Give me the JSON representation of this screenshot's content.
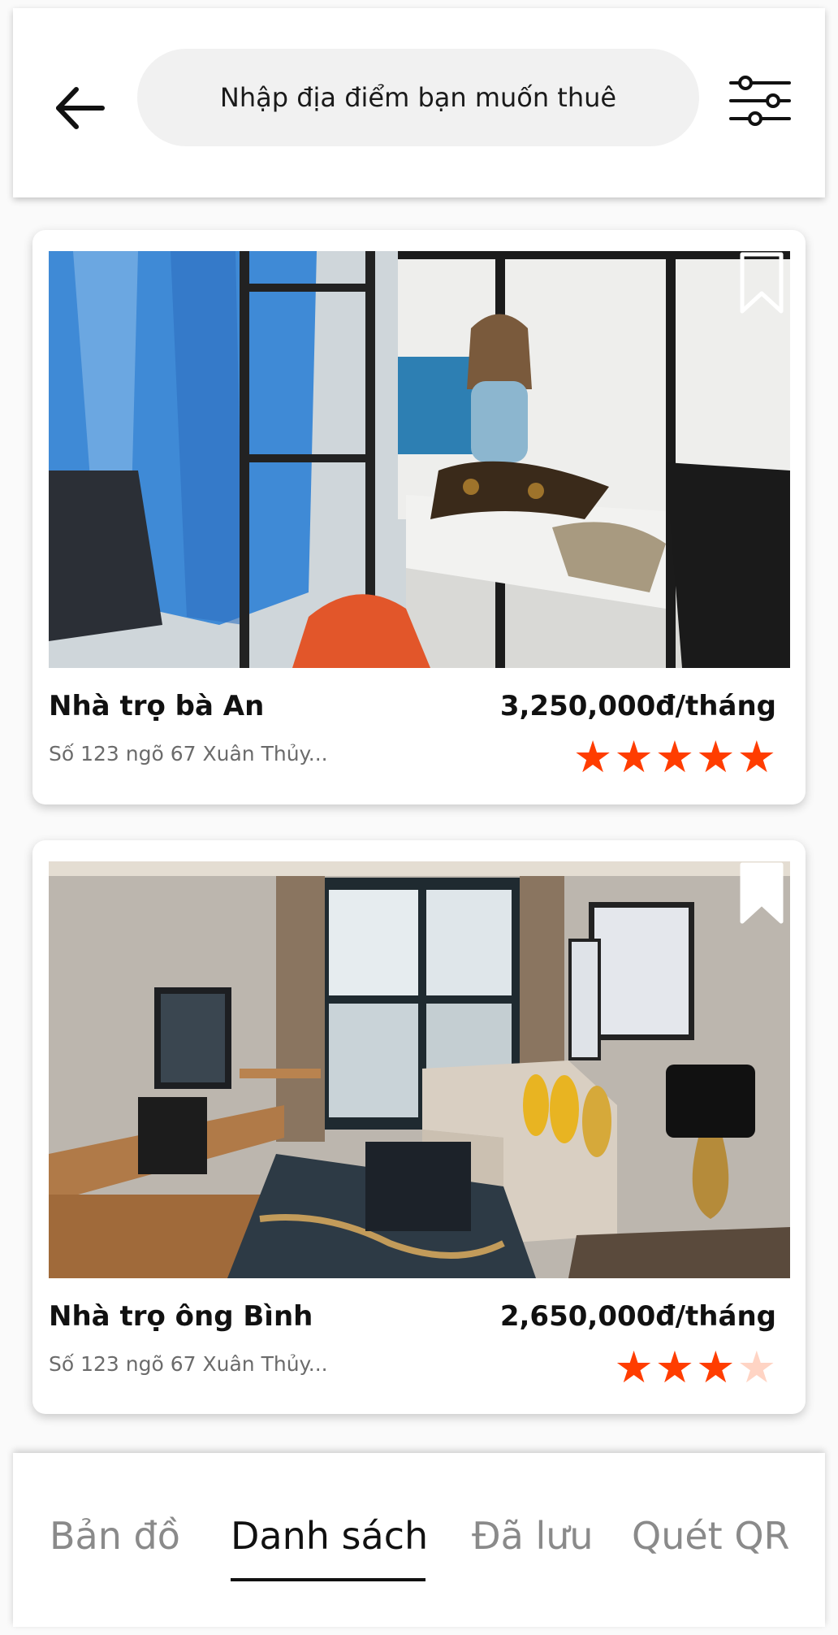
{
  "header": {
    "search_placeholder": "Nhập địa điểm bạn muốn thuê",
    "back_icon": "arrow-left-icon",
    "filter_icon": "sliders-icon"
  },
  "listings": [
    {
      "name": "Nhà trọ bà An",
      "price": "3,250,000đ/tháng",
      "address": "Số 123 ngõ 67 Xuân Thủy...",
      "rating": 5,
      "rating_max": 5,
      "bookmarked": false,
      "bookmark_icon": "bookmark-outline-icon",
      "image_icon": "dorm-room-photo"
    },
    {
      "name": "Nhà trọ ông Bình",
      "price": "2,650,000đ/tháng",
      "address": "Số 123 ngõ 67 Xuân Thủy...",
      "rating": 3,
      "rating_max": 4,
      "bookmarked": true,
      "bookmark_icon": "bookmark-filled-icon",
      "image_icon": "living-room-photo"
    }
  ],
  "nav": {
    "tabs": [
      {
        "label": "Bản đồ",
        "active": false
      },
      {
        "label": "Danh sách",
        "active": true
      },
      {
        "label": "Đã lưu",
        "active": false
      },
      {
        "label": "Quét QR",
        "active": false
      }
    ]
  },
  "colors": {
    "star": "#ff3d00",
    "star_dim": "#ffd4c4",
    "search_bg": "#f1f1f1"
  }
}
